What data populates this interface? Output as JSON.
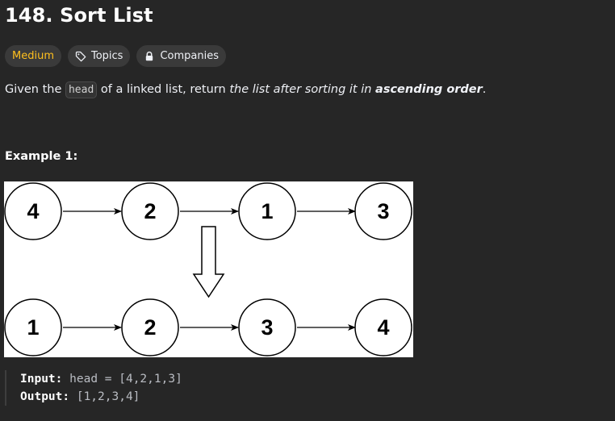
{
  "problem": {
    "title": "148. Sort List",
    "difficulty": "Medium",
    "topics_label": "Topics",
    "companies_label": "Companies"
  },
  "description": {
    "part1": "Given the ",
    "code": "head",
    "part2": " of a linked list, return ",
    "italic": "the list after sorting it in ",
    "bold": "ascending order",
    "period": "."
  },
  "example": {
    "title": "Example 1:",
    "input_label": "Input:",
    "input_value": "head = [4,2,1,3]",
    "output_label": "Output:",
    "output_value": "[1,2,3,4]",
    "diagram": {
      "top_row": [
        "4",
        "2",
        "1",
        "3"
      ],
      "bottom_row": [
        "1",
        "2",
        "3",
        "4"
      ]
    }
  },
  "colors": {
    "background": "#262626",
    "difficulty": "#ffc01e",
    "tag_bg": "#3a3a3a"
  }
}
